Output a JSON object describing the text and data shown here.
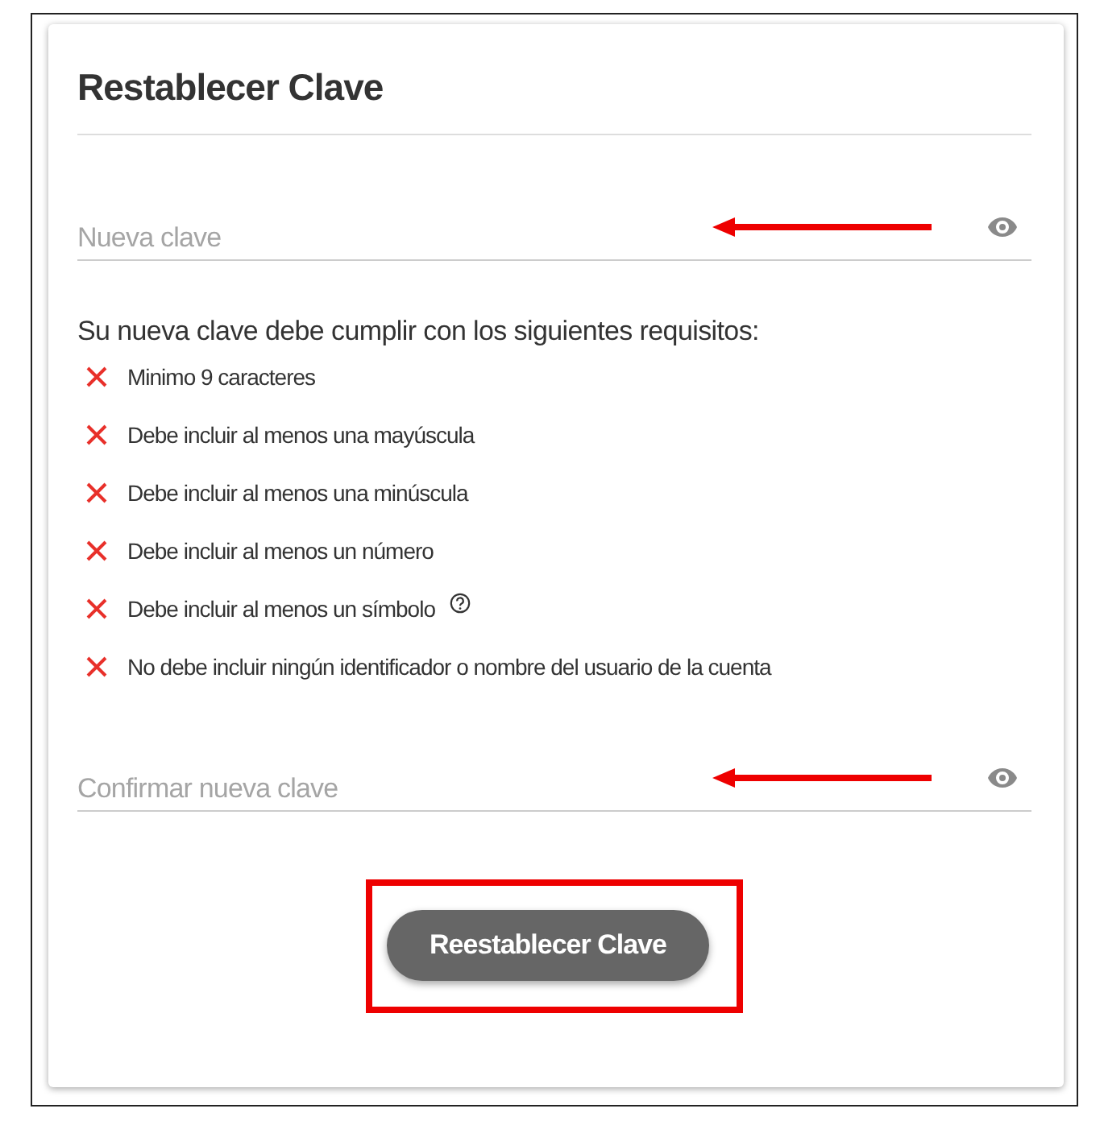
{
  "title": "Restablecer Clave",
  "new_password": {
    "placeholder": "Nueva clave",
    "annotated": true
  },
  "requirements_intro": "Su nueva clave debe cumplir con los siguientes requisitos:",
  "requirements": [
    {
      "text": "Minimo 9 caracteres",
      "met": false,
      "help": false
    },
    {
      "text": "Debe incluir al menos una mayúscula",
      "met": false,
      "help": false
    },
    {
      "text": "Debe incluir al menos una minúscula",
      "met": false,
      "help": false
    },
    {
      "text": "Debe incluir al menos un número",
      "met": false,
      "help": false
    },
    {
      "text": "Debe incluir al menos un símbolo",
      "met": false,
      "help": true
    },
    {
      "text": "No debe incluir ningún identificador o nombre del usuario de la cuenta",
      "met": false,
      "help": false
    }
  ],
  "confirm_password": {
    "placeholder": "Confirmar nueva clave",
    "annotated": true
  },
  "submit": {
    "label": "Reestablecer Clave",
    "annotated": true
  }
}
